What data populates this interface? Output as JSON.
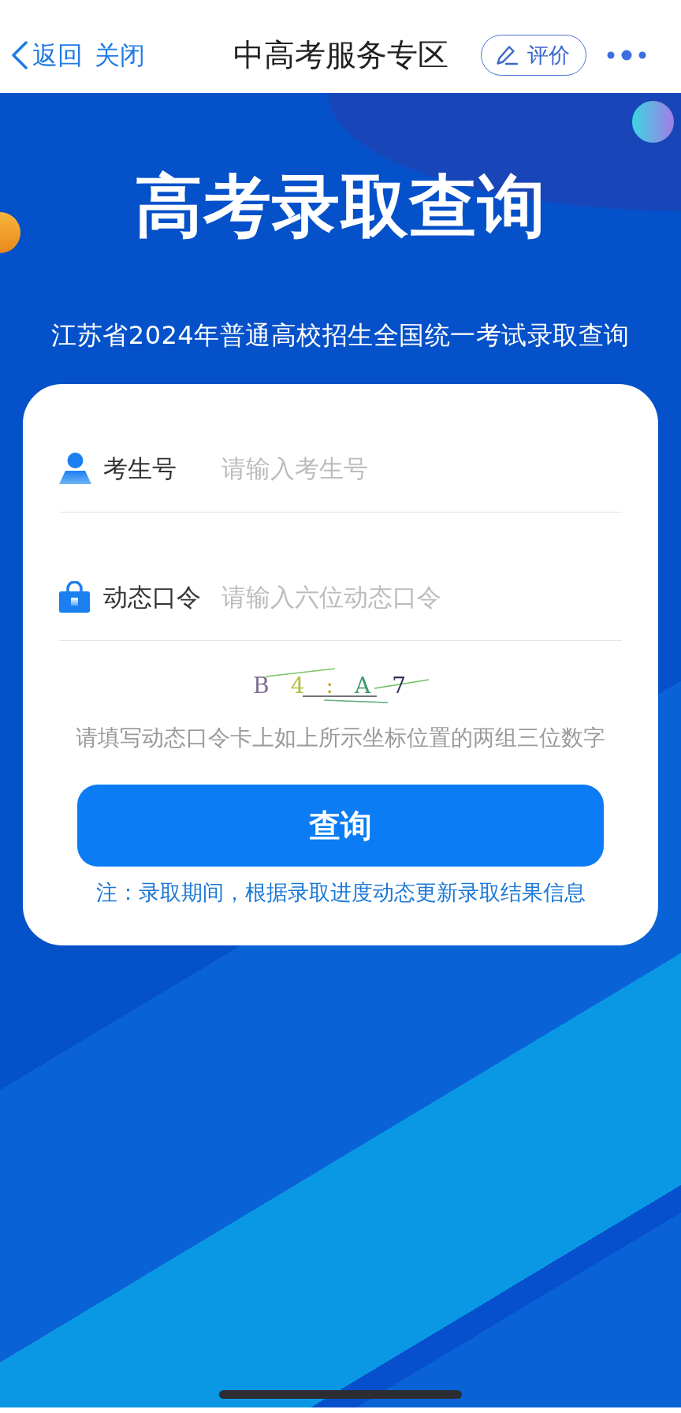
{
  "nav": {
    "back": "返回",
    "close": "关闭",
    "title": "中高考服务专区",
    "rate": "评价"
  },
  "banner": {
    "title": "高考录取查询",
    "subtitle": "江苏省2024年普通高校招生全国统一考试录取查询"
  },
  "form": {
    "fields": [
      {
        "label": "考生号",
        "placeholder": "请输入考生号"
      },
      {
        "label": "动态口令",
        "placeholder": "请输入六位动态口令"
      }
    ],
    "captcha": [
      {
        "char": "B",
        "color": "#7b6e8f"
      },
      {
        "char": "4",
        "color": "#b3bd45"
      },
      {
        "char": ":",
        "color": "#c9a233"
      },
      {
        "char": "A",
        "color": "#3f9a6a"
      },
      {
        "char": "7",
        "color": "#2c2f5c"
      }
    ],
    "hint": "请填写动态口令卡上如上所示坐标位置的两组三位数字",
    "submit": "查询",
    "note": "注：录取期间，根据录取进度动态更新录取结果信息"
  }
}
